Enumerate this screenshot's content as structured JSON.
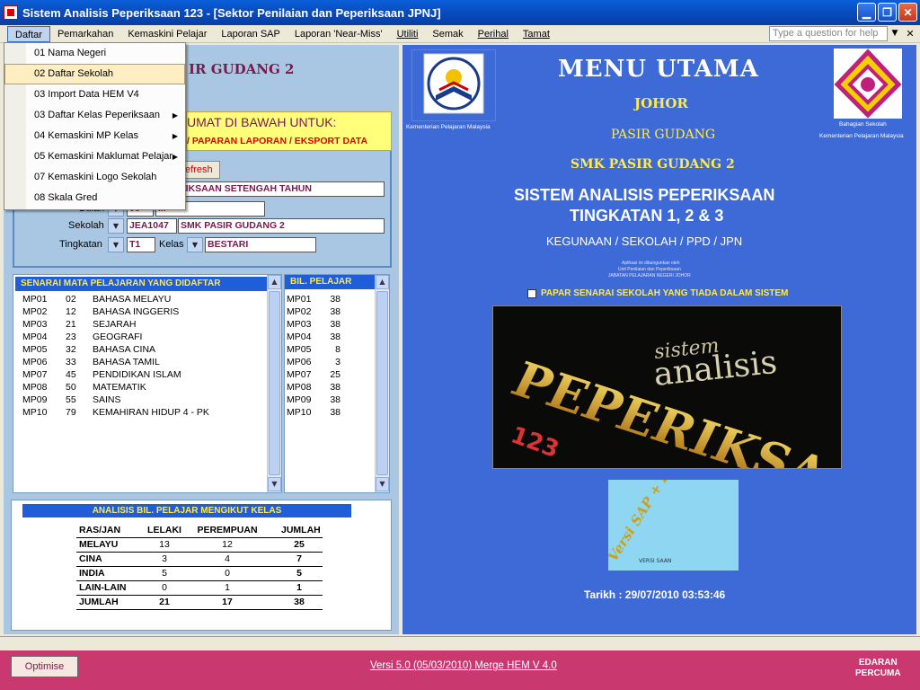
{
  "window": {
    "title": "Sistem Analisis Peperiksaan 123 - [Sektor Penilaian dan Peperiksaan JPNJ]"
  },
  "menubar": {
    "items": [
      "Daftar",
      "Pemarkahan",
      "Kemaskini Pelajar",
      "Laporan SAP",
      "Laporan 'Near-Miss'",
      "Utiliti",
      "Semak",
      "Perihal",
      "Tamat"
    ],
    "help_placeholder": "Type a question for help"
  },
  "daftar_menu": [
    {
      "label": "01 Nama Negeri",
      "submenu": false
    },
    {
      "label": "02 Daftar Sekolah",
      "submenu": false,
      "selected": true
    },
    {
      "label": "03 Import Data HEM V4",
      "submenu": false
    },
    {
      "label": "03 Daftar Kelas Peperiksaan",
      "submenu": true
    },
    {
      "label": "04 Kemaskini MP Kelas",
      "submenu": true
    },
    {
      "label": "05 Kemaskini Maklumat Pelajar",
      "submenu": true
    },
    {
      "label": "07 Kemaskini Logo Sekolah",
      "submenu": false
    },
    {
      "label": "08 Skala Gred",
      "submenu": false
    }
  ],
  "left": {
    "school_title_partial": "IR GUDANG 2",
    "yellow_line1": "UMAT DI BAWAH UNTUK:",
    "yellow_line2": "/ PAPARAN LAPORAN / EKSPORT DATA",
    "refresh_label": "efresh",
    "exam_field": "RIKSAAN SETENGAH TAHUN",
    "bulan_label": "Bulan",
    "bulan_code": "06",
    "bulan_name": "...",
    "sekolah_label": "Sekolah",
    "sekolah_code": "JEA1047",
    "sekolah_name": "SMK PASIR GUDANG 2",
    "tingkatan_label": "Tingkatan",
    "tingkatan_value": "T1",
    "kelas_label": "Kelas",
    "kelas_value": "BESTARI"
  },
  "subjects": {
    "header": "SENARAI MATA PELAJARAN YANG DIDAFTAR",
    "rows": [
      {
        "mp": "MP01",
        "code": "02",
        "name": "BAHASA MELAYU"
      },
      {
        "mp": "MP02",
        "code": "12",
        "name": "BAHASA INGGERIS"
      },
      {
        "mp": "MP03",
        "code": "21",
        "name": "SEJARAH"
      },
      {
        "mp": "MP04",
        "code": "23",
        "name": "GEOGRAFI"
      },
      {
        "mp": "MP05",
        "code": "32",
        "name": "BAHASA CINA"
      },
      {
        "mp": "MP06",
        "code": "33",
        "name": "BAHASA TAMIL"
      },
      {
        "mp": "MP07",
        "code": "45",
        "name": "PENDIDIKAN ISLAM"
      },
      {
        "mp": "MP08",
        "code": "50",
        "name": "MATEMATIK"
      },
      {
        "mp": "MP09",
        "code": "55",
        "name": "SAINS"
      },
      {
        "mp": "MP10",
        "code": "79",
        "name": "KEMAHIRAN HIDUP 4 - PK"
      }
    ]
  },
  "bil": {
    "header": "BIL. PELAJAR",
    "rows": [
      {
        "mp": "MP01",
        "n": "38"
      },
      {
        "mp": "MP02",
        "n": "38"
      },
      {
        "mp": "MP03",
        "n": "38"
      },
      {
        "mp": "MP04",
        "n": "38"
      },
      {
        "mp": "MP05",
        "n": "8"
      },
      {
        "mp": "MP06",
        "n": "3"
      },
      {
        "mp": "MP07",
        "n": "25"
      },
      {
        "mp": "MP08",
        "n": "38"
      },
      {
        "mp": "MP09",
        "n": "38"
      },
      {
        "mp": "MP10",
        "n": "38"
      }
    ]
  },
  "analysis": {
    "header": "ANALISIS BIL. PELAJAR MENGIKUT KELAS",
    "columns": [
      "RAS/JAN",
      "LELAKI",
      "PEREMPUAN",
      "JUMLAH"
    ],
    "rows": [
      [
        "MELAYU",
        "13",
        "12",
        "25"
      ],
      [
        "CINA",
        "3",
        "4",
        "7"
      ],
      [
        "INDIA",
        "5",
        "0",
        "5"
      ],
      [
        "LAIN-LAIN",
        "0",
        "1",
        "1"
      ],
      [
        "JUMLAH",
        "21",
        "17",
        "38"
      ]
    ]
  },
  "right": {
    "menu_title": "MENU UTAMA",
    "negeri": "JOHOR",
    "daerah": "PASIR GUDANG",
    "sekolah": "SMK PASIR GUDANG 2",
    "sys_line1": "SISTEM ANALISIS PEPERIKSAAN",
    "sys_line2": "TINGKATAN 1, 2 & 3",
    "kegunaan": "KEGUNAAN / SEKOLAH / PPD  / JPN",
    "fine1": "Aplikasi ini dibangunkan oleh",
    "fine2": "Unit Penilaian dan Peperiksaan",
    "fine3": "JABATAN PELAJARAN NEGERI JOHOR",
    "checkbox_label": "PAPAR SENARAI SEKOLAH  YANG TIADA DALAM SISTEM",
    "logo_left_caption": "Kementerian Pelajaran Malaysia",
    "logo_right_caption1": "Bahagian Sekolah",
    "logo_right_caption2": "Kementerian Pelajaran Malaysia",
    "banner_small": "sistem",
    "banner_mid": "analisis",
    "banner_big": "PEPERIKSAAN",
    "banner_num": "123",
    "versi_big": "Versi SAP + Head Count",
    "versi_small": "VERSI SAAN",
    "tarikh": "Tarikh : 29/07/2010    03:53:46"
  },
  "status": {
    "optimise": "Optimise",
    "version": "Versi 5.0 (05/03/2010) Merge HEM V 4.0",
    "edaran1": "EDARAN",
    "edaran2": "PERCUMA"
  }
}
